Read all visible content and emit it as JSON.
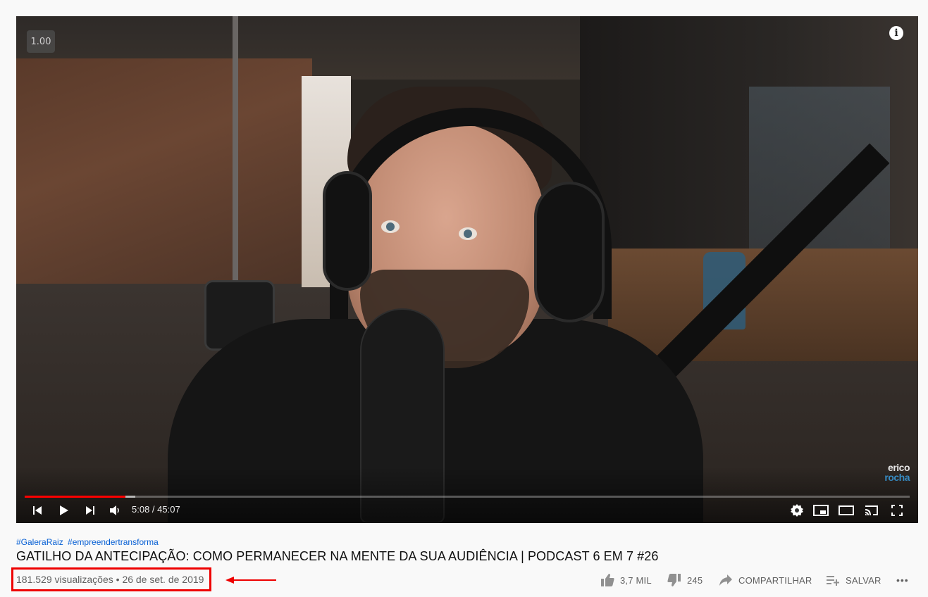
{
  "player": {
    "speed_badge": "1.00",
    "info_icon": "i",
    "watermark_line1": "erico",
    "watermark_line2": "rocha",
    "time_current": "5:08",
    "time_total": "45:07",
    "time_display": "5:08 / 45:07",
    "progress_played_fraction": 0.114,
    "progress_loaded_fraction": 0.125,
    "icons": [
      "previous-icon",
      "play-icon",
      "next-icon",
      "volume-icon",
      "settings-icon",
      "miniplayer-icon",
      "theater-icon",
      "cast-icon",
      "fullscreen-icon"
    ]
  },
  "video": {
    "hashtags": [
      "#GaleraRaiz",
      "#empreendertransforma"
    ],
    "title": "GATILHO DA ANTECIPAÇÃO: COMO PERMANECER NA MENTE DA SUA AUDIÊNCIA | PODCAST 6 EM 7 #26",
    "views_date": "181.529 visualizações • 26 de set. de 2019"
  },
  "actions": {
    "like_count": "3,7 MIL",
    "dislike_count": "245",
    "share_label": "COMPARTILHAR",
    "save_label": "SALVAR",
    "more_label": "•••"
  },
  "annotation": {
    "highlight_color": "#e00000"
  }
}
